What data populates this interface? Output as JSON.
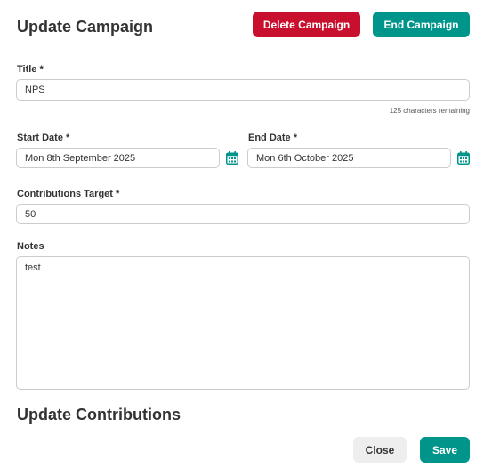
{
  "dialog": {
    "title": "Update Campaign",
    "delete_label": "Delete Campaign",
    "end_label": "End Campaign",
    "section_title": "Update Contributions",
    "close_label": "Close",
    "save_label": "Save"
  },
  "form": {
    "title_label": "Title *",
    "title_value": "NPS",
    "char_remaining": "125 characters remaining",
    "start_label": "Start Date *",
    "start_value": "Mon 8th September 2025",
    "end_label": "End Date *",
    "end_value": "Mon 6th October 2025",
    "target_label": "Contributions Target *",
    "target_value": "50",
    "notes_label": "Notes",
    "notes_value": "test"
  },
  "icons": {
    "calendar": "calendar-icon"
  },
  "colors": {
    "danger": "#c8102e",
    "accent": "#00958a",
    "neutral": "#eeeeee"
  }
}
